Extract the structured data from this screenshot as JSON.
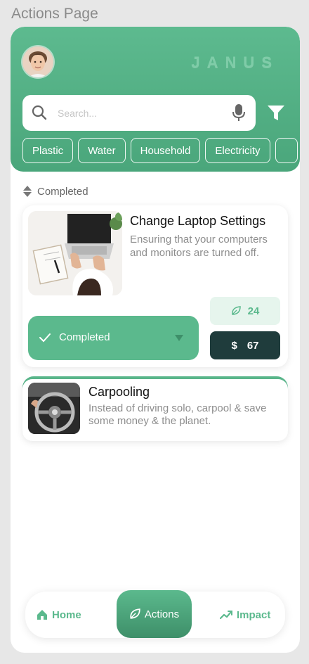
{
  "page_label": "Actions Page",
  "header": {
    "brand": "JANUS",
    "avatar_icon": "user-avatar"
  },
  "search": {
    "placeholder": "Search...",
    "value": ""
  },
  "categories": [
    "Plastic",
    "Water",
    "Household",
    "Electricity"
  ],
  "sort": {
    "label": "Completed"
  },
  "actions": [
    {
      "title": "Change Laptop Settings",
      "description": "Ensuring that your computers and monitors are turned off.",
      "status": "Completed",
      "points": "24",
      "currency": "$",
      "savings": "67"
    },
    {
      "title": "Carpooling",
      "description": "Instead of driving solo, carpool & save some money & the planet."
    }
  ],
  "nav": {
    "home": "Home",
    "actions": "Actions",
    "impact": "Impact"
  },
  "colors": {
    "primary": "#5bb98d",
    "dark": "#1f3c3c",
    "light_green": "#e6f5ed"
  }
}
